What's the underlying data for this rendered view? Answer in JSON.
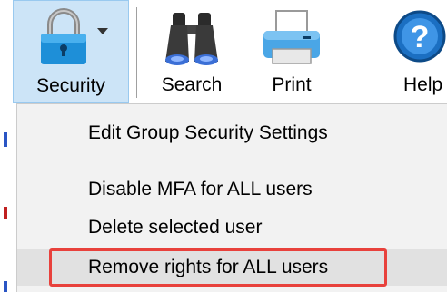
{
  "toolbar": {
    "buttons": [
      {
        "label": "Security",
        "icon": "padlock-icon",
        "has_dropdown": true
      },
      {
        "label": "Search",
        "icon": "binoculars-icon"
      },
      {
        "label": "Print",
        "icon": "printer-icon"
      },
      {
        "label": "Help",
        "icon": "help-icon"
      }
    ]
  },
  "menu": {
    "items": [
      {
        "label": "Edit Group Security Settings"
      },
      {
        "label": "Disable MFA for ALL users"
      },
      {
        "label": "Delete selected user"
      },
      {
        "label": "Remove rights for ALL users",
        "highlighted": true
      }
    ]
  },
  "colors": {
    "selected_button_bg": "#cce4f7",
    "highlight_border": "#e8413c",
    "menu_bg": "#f2f2f2"
  }
}
